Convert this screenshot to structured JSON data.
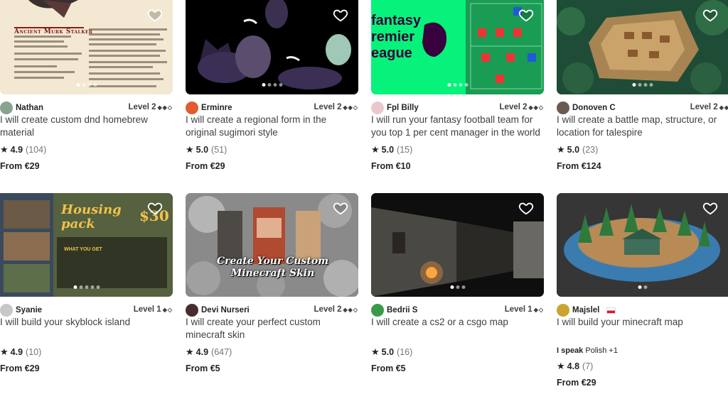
{
  "gigs": [
    {
      "seller": "Nathan",
      "level": "Level 2",
      "title": "I will create custom dnd homebrew material",
      "rating": "4.9",
      "count": "(104)",
      "price": "From €29",
      "thumb_title": "Ancient Murk Stalker"
    },
    {
      "seller": "Erminre",
      "level": "Level 2",
      "title": "I will create a regional form in the original sugimori style",
      "rating": "5.0",
      "count": "(51)",
      "price": "From €29"
    },
    {
      "seller": "Fpl Billy",
      "level": "Level 2",
      "title": "I will run your fantasy football team for you top 1 per cent manager in the world",
      "rating": "5.0",
      "count": "(15)",
      "price": "From €10",
      "thumb_title": "fantasy\nremier\neague"
    },
    {
      "seller": "Donoven C",
      "level": "Level 2",
      "title": "I will create a battle map, structure, or location for talespire",
      "rating": "5.0",
      "count": "(23)",
      "price": "From €124"
    },
    {
      "seller": "Syanie",
      "level": "Level 1",
      "title": "I will build your skyblock island",
      "rating": "4.9",
      "count": "(10)",
      "price": "From €29",
      "thumb_title": "Housing pack",
      "thumb_price": "$30",
      "thumb_sub": "WHAT YOU GET"
    },
    {
      "seller": "Devi Nurseri",
      "level": "Level 2",
      "title": "I will create your perfect custom minecraft skin",
      "rating": "4.9",
      "count": "(647)",
      "price": "From €5",
      "thumb_title": "Create Your Custom Minecraft Skin"
    },
    {
      "seller": "Bedrii S",
      "level": "Level 1",
      "title": "I will create a cs2 or a csgo map",
      "rating": "5.0",
      "count": "(16)",
      "price": "From €5"
    },
    {
      "seller": "Majslel",
      "level": "",
      "title": "I will build your minecraft map",
      "rating": "4.8",
      "count": "(7)",
      "price": "From €29",
      "speak_label": "I speak",
      "speak_lang": "Polish",
      "speak_more": "+1"
    }
  ],
  "icons": {
    "heart": "heart-icon",
    "star": "star-icon",
    "diamond": "level-diamond-icon"
  }
}
